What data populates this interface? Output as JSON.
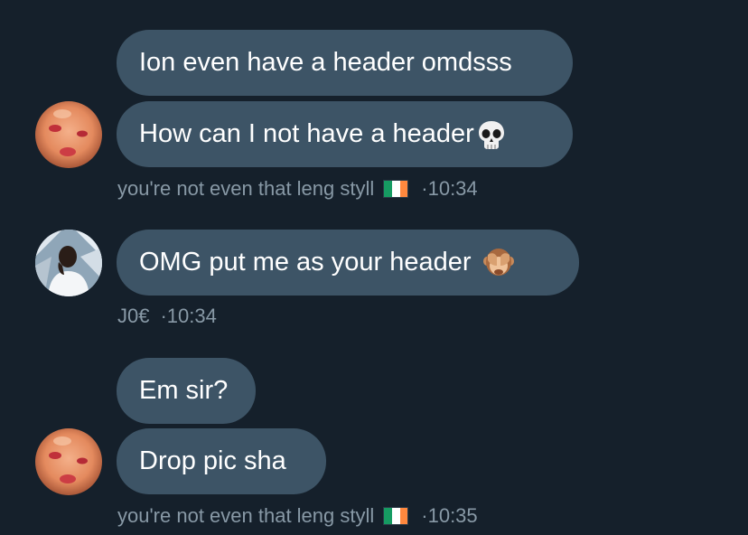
{
  "conversation": {
    "groups": [
      {
        "messages": [
          {
            "text": "Ion even have a header omdsss"
          },
          {
            "text": "How can I not have a header",
            "emoji": "skull"
          }
        ],
        "meta": {
          "sender": "you're not even that leng styll",
          "flag": "flag-ireland",
          "time": "·10:34"
        }
      },
      {
        "messages": [
          {
            "text": "OMG put me as your header",
            "emoji": "see-no-evil-monkey"
          }
        ],
        "meta": {
          "sender": "J0€",
          "time": "·10:34"
        }
      },
      {
        "messages": [
          {
            "text": "Em sir?"
          },
          {
            "text": "Drop pic sha"
          }
        ],
        "meta": {
          "sender": "you're not even that leng styll",
          "flag": "flag-ireland",
          "time": "·10:35"
        }
      }
    ]
  },
  "colors": {
    "background": "#15202b",
    "bubble": "#3d5466",
    "bubble_text": "#ffffff",
    "meta_text": "#8899a6",
    "flag_green": "#169b62",
    "flag_white": "#ffffff",
    "flag_orange": "#ff883e"
  }
}
